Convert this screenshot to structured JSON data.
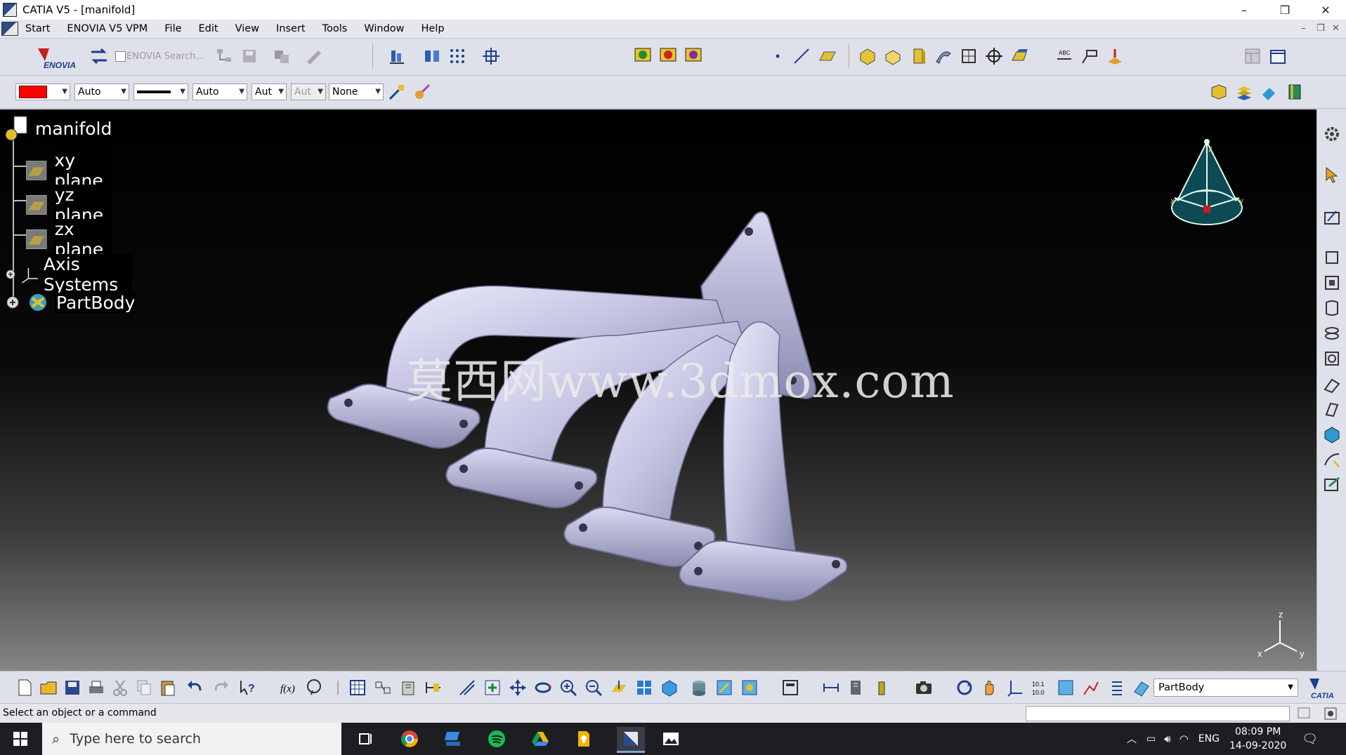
{
  "window": {
    "title": "CATIA V5 - [manifold]",
    "minimize": "–",
    "restore": "❐",
    "close": "✕"
  },
  "menu": {
    "items": [
      "Start",
      "ENOVIA V5 VPM",
      "File",
      "Edit",
      "View",
      "Insert",
      "Tools",
      "Window",
      "Help"
    ],
    "mdi_controls": [
      "–",
      "❐",
      "✕"
    ]
  },
  "toolbar": {
    "enovia_search_label": "ENOVIA Search...",
    "color_combo": {
      "value": "",
      "swatch": "#ff0000"
    },
    "transparency_combo": {
      "value": "Auto"
    },
    "line_type_combo": {
      "value": ""
    },
    "thickness_combo": {
      "value": "Auto"
    },
    "linetype2_combo": {
      "value": "Aut"
    },
    "point_combo": {
      "value": "Aut"
    },
    "layer_combo": {
      "value": "None"
    }
  },
  "tree": {
    "root": "manifold",
    "items": [
      {
        "label": "xy plane",
        "icon": "plane-icon"
      },
      {
        "label": "yz plane",
        "icon": "plane-icon"
      },
      {
        "label": "zx plane",
        "icon": "plane-icon"
      },
      {
        "label": "Axis Systems",
        "icon": "axis-systems-icon"
      },
      {
        "label": "PartBody",
        "icon": "partbody-icon"
      }
    ]
  },
  "viewport": {
    "watermark": "莫西网www.3dmox.com",
    "compass_labels": {
      "z": "z",
      "x": "x",
      "y": "y"
    },
    "axis_labels": {
      "z": "z",
      "x": "x",
      "y": "y"
    },
    "colors": {
      "background_top": "#000000",
      "background_bottom": "#858585",
      "part": "#c9c9e8"
    }
  },
  "bottom_toolbar": {
    "current_body": "PartBody"
  },
  "status": {
    "message": "Select an object or a command",
    "command_input": ""
  },
  "taskbar": {
    "search_placeholder": "Type here to search",
    "language": "ENG",
    "time": "08:09 PM",
    "date": "14-09-2020"
  }
}
